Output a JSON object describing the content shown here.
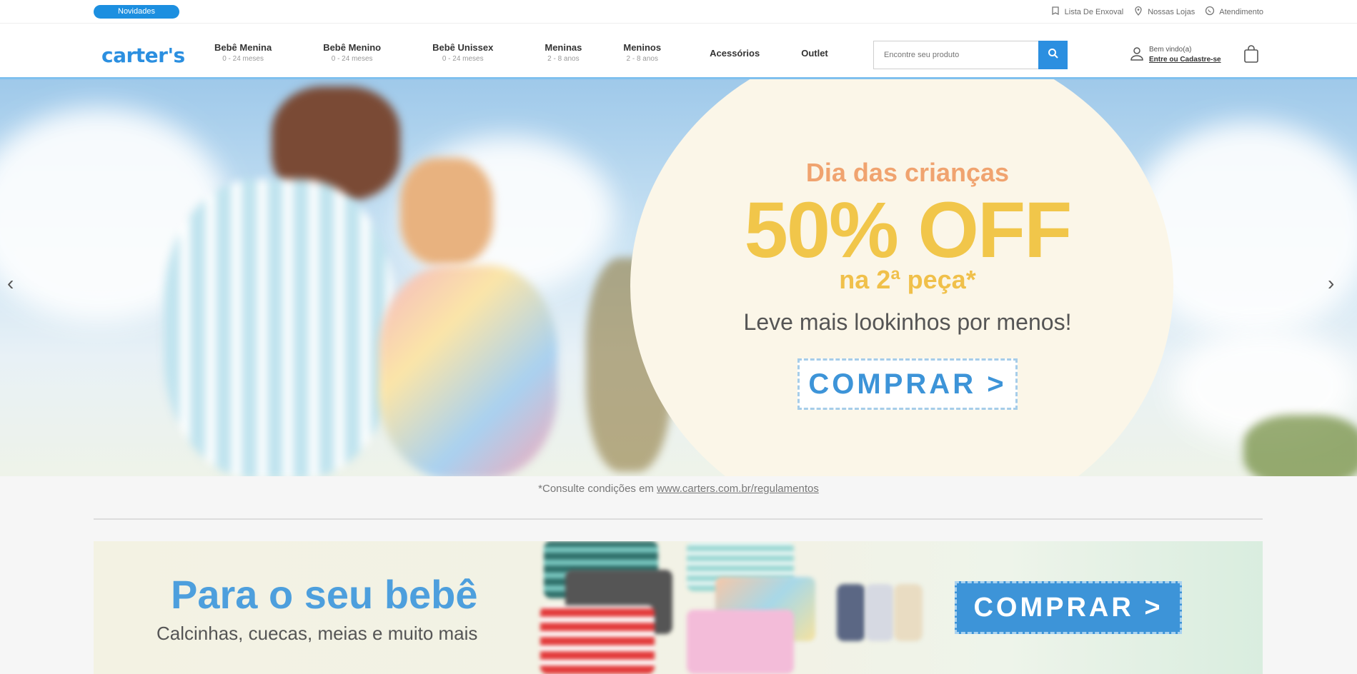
{
  "topbar": {
    "badge": "Novidades",
    "links": [
      "Lista De Enxoval",
      "Nossas Lojas",
      "Atendimento"
    ]
  },
  "header": {
    "logo": "carter's",
    "nav": [
      {
        "label": "Bebê Menina",
        "sub": "0 - 24 meses"
      },
      {
        "label": "Bebê Menino",
        "sub": "0 - 24 meses"
      },
      {
        "label": "Bebê Unissex",
        "sub": "0 - 24 meses"
      },
      {
        "label": "Meninas",
        "sub": "2 - 8 anos"
      },
      {
        "label": "Meninos",
        "sub": "2 - 8 anos"
      },
      {
        "label": "Acessórios",
        "sub": ""
      },
      {
        "label": "Outlet",
        "sub": ""
      }
    ],
    "search_placeholder": "Encontre seu produto",
    "account_greeting": "Bem vindo(a)",
    "account_link": "Entre ou Cadastre-se"
  },
  "hero": {
    "title": "Dia das crianças",
    "discount": "50% OFF",
    "subtitle": "na 2ª peça*",
    "tagline": "Leve mais lookinhos por menos!",
    "cta": "COMPRAR >"
  },
  "disclaimer": {
    "text": "*Consulte condições em ",
    "link": "www.carters.com.br/regulamentos"
  },
  "banner2": {
    "title": "Para o seu bebê",
    "subtitle": "Calcinhas, cuecas, meias e muito mais",
    "cta": "COMPRAR >"
  },
  "colors": {
    "brand_blue": "#2b8fe0",
    "promo_yellow": "#f1c64a",
    "promo_orange": "#f0a36f"
  }
}
